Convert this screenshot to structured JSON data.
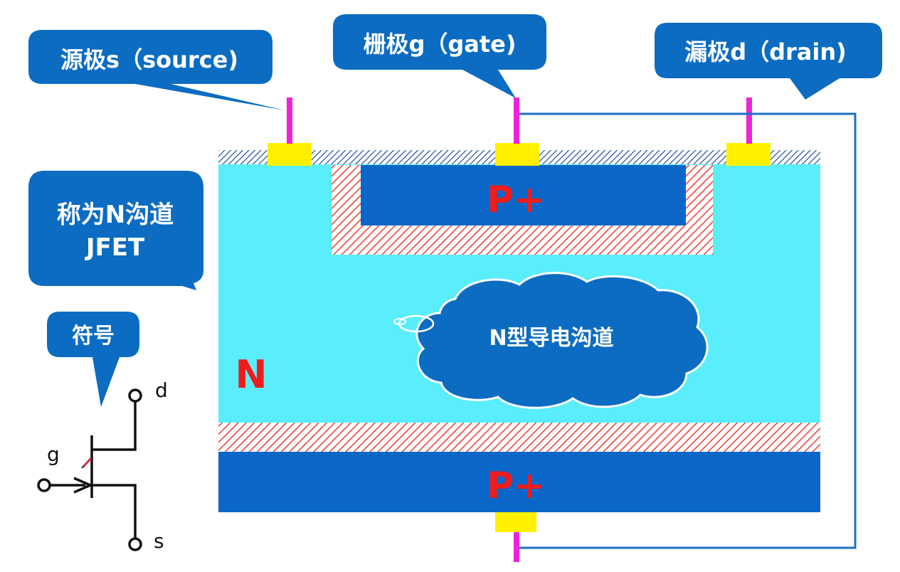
{
  "callouts": {
    "source": "源极s（source)",
    "gate": "栅极g（gate)",
    "drain": "漏极d（drain)",
    "name_line1": "称为N沟道",
    "name_line2": "JFET",
    "symbol": "符号"
  },
  "regions": {
    "top_gate": "P+",
    "bottom_gate": "P+",
    "substrate": "N",
    "channel_cloud": "N型导电沟道"
  },
  "symbol_terminals": {
    "d": "d",
    "g": "g",
    "s": "s"
  },
  "colors": {
    "callout_blue": "#0b6cc2",
    "p_region_blue": "#0a67c8",
    "n_region_cyan": "#5aedfb",
    "contact_yellow": "#fff000",
    "lead_magenta": "#ee22d8",
    "depletion_red": "#e8493a",
    "label_red": "#ee1c1c",
    "wire_blue": "#1a6fc6"
  }
}
